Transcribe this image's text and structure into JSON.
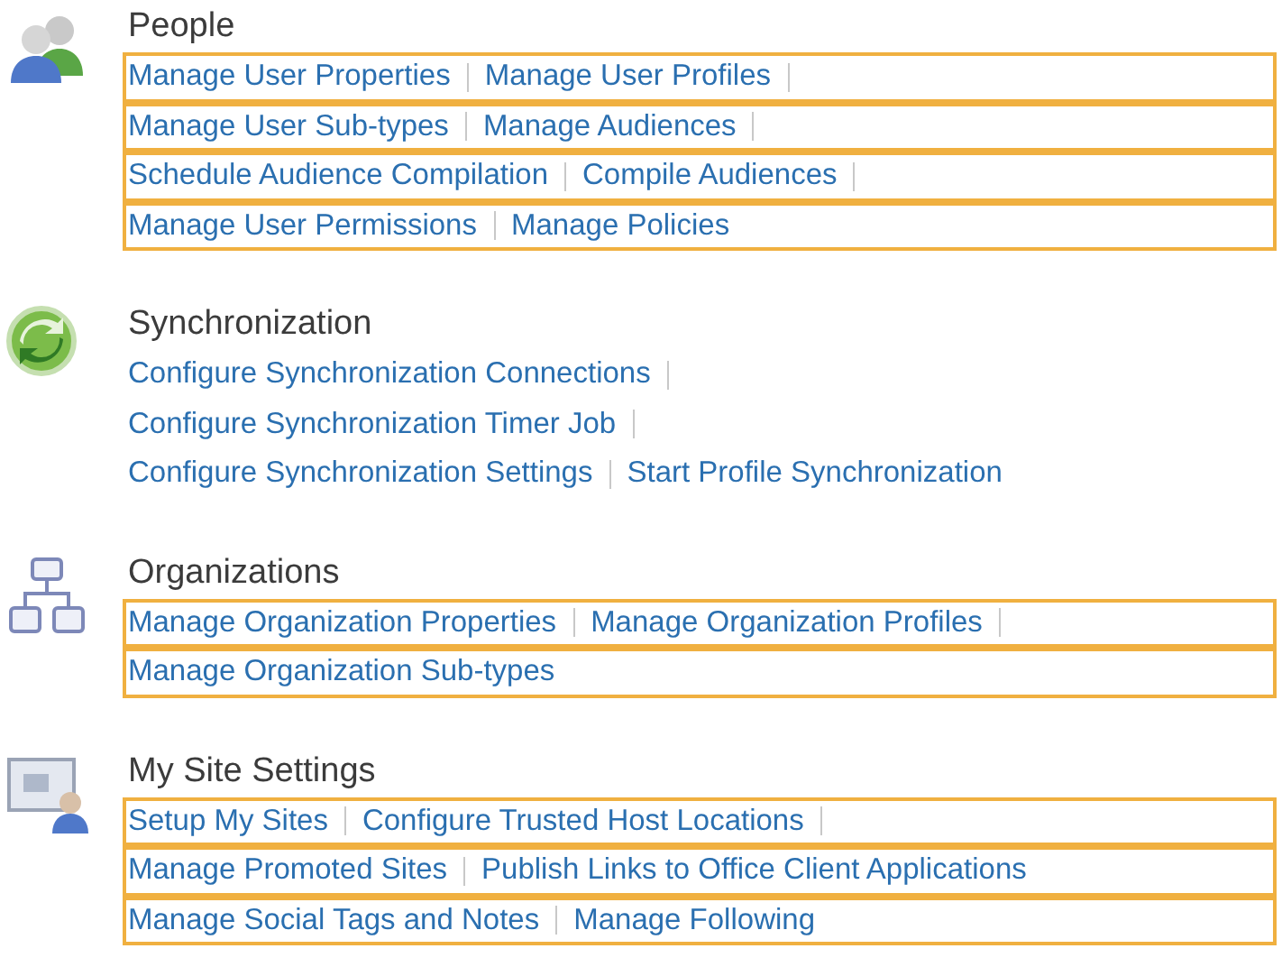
{
  "sections": [
    {
      "title": "People",
      "kind": "people",
      "rows": [
        {
          "highlighted": true,
          "trailing_separator": true,
          "links": [
            "Manage User Properties",
            "Manage User Profiles"
          ]
        },
        {
          "highlighted": true,
          "trailing_separator": true,
          "links": [
            "Manage User Sub-types",
            "Manage Audiences"
          ]
        },
        {
          "highlighted": true,
          "trailing_separator": true,
          "links": [
            "Schedule Audience Compilation",
            "Compile Audiences"
          ]
        },
        {
          "highlighted": true,
          "trailing_separator": false,
          "links": [
            "Manage User Permissions",
            "Manage Policies"
          ]
        }
      ]
    },
    {
      "title": "Synchronization",
      "kind": "sync",
      "rows": [
        {
          "highlighted": false,
          "trailing_separator": true,
          "links": [
            "Configure Synchronization Connections"
          ]
        },
        {
          "highlighted": false,
          "trailing_separator": true,
          "links": [
            "Configure Synchronization Timer Job"
          ]
        },
        {
          "highlighted": false,
          "trailing_separator": false,
          "links": [
            "Configure Synchronization Settings",
            "Start Profile Synchronization"
          ]
        }
      ]
    },
    {
      "title": "Organizations",
      "kind": "org",
      "rows": [
        {
          "highlighted": true,
          "trailing_separator": true,
          "links": [
            "Manage Organization Properties",
            "Manage Organization Profiles"
          ]
        },
        {
          "highlighted": true,
          "trailing_separator": false,
          "links": [
            "Manage Organization Sub-types"
          ]
        }
      ]
    },
    {
      "title": "My Site Settings",
      "kind": "mysite",
      "rows": [
        {
          "highlighted": true,
          "trailing_separator": true,
          "links": [
            "Setup My Sites",
            "Configure Trusted Host Locations"
          ]
        },
        {
          "highlighted": true,
          "trailing_separator": false,
          "links": [
            "Manage Promoted Sites",
            "Publish Links to Office Client Applications"
          ]
        },
        {
          "highlighted": true,
          "trailing_separator": false,
          "links": [
            "Manage Social Tags and Notes",
            "Manage Following"
          ]
        }
      ]
    }
  ]
}
